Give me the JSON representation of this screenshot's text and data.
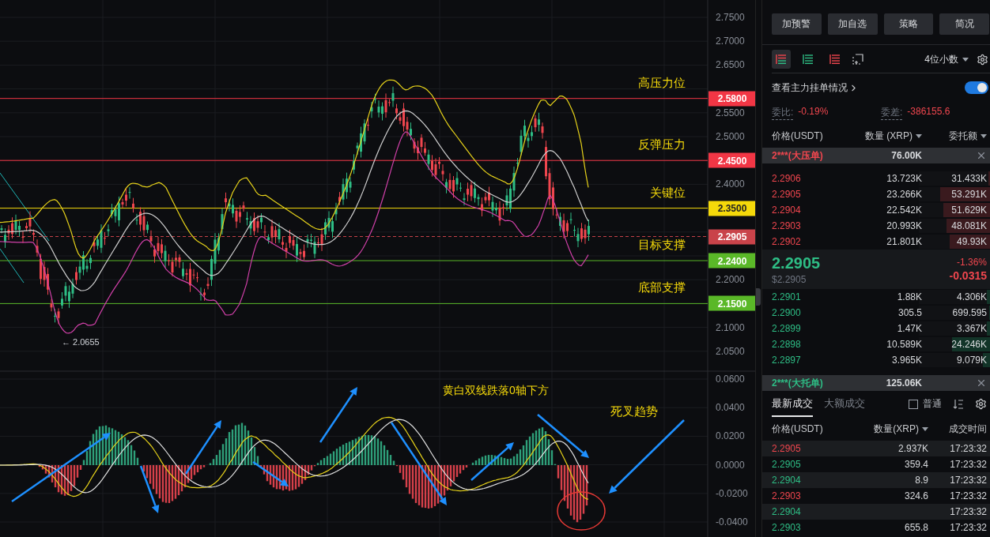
{
  "chart": {
    "price_ticks": [
      "2.7500",
      "2.7000",
      "2.6500",
      "2.5500",
      "2.5000",
      "2.4000",
      "2.2000",
      "2.1000",
      "2.0500"
    ],
    "macd_ticks": [
      "0.0600",
      "0.0400",
      "0.0200",
      "0.0000",
      "-0.0200",
      "-0.0400"
    ],
    "levels": [
      {
        "price": "2.5800",
        "kind": "resistance",
        "color": "#f23645",
        "note": "高压力位"
      },
      {
        "price": "2.4500",
        "kind": "resistance",
        "color": "#f23645",
        "note": "反弹压力"
      },
      {
        "price": "2.3500",
        "kind": "key",
        "color": "#f5d90a",
        "note": "关键位"
      },
      {
        "price": "2.2905",
        "kind": "current",
        "color": "#c9434a"
      },
      {
        "price": "2.2400",
        "kind": "support",
        "color": "#5ab828",
        "note": "目标支撑"
      },
      {
        "price": "2.1500",
        "kind": "support",
        "color": "#5ab828",
        "note": "底部支撑"
      }
    ],
    "low_marker": "← 2.0655",
    "macd_notes": [
      "黄白双线跌落0轴下方",
      "死叉趋势"
    ]
  },
  "panel": {
    "actions": [
      "加预警",
      "加自选",
      "策略",
      "简况"
    ],
    "depth_views": [
      {
        "kind": "both",
        "selected": true
      },
      {
        "kind": "bids",
        "selected": false
      },
      {
        "kind": "asks",
        "selected": false
      }
    ],
    "precision": "4位小数",
    "main_orders": {
      "label": "查看主力挂单情况",
      "on": true
    },
    "stats": [
      {
        "label": "委比:",
        "value": "-0.19%"
      },
      {
        "label": "委差:",
        "value": "-386155.6"
      }
    ],
    "book_columns": [
      "价格(USDT)",
      "数量 (XRP)",
      "委托额"
    ],
    "big_ask": {
      "label": "2***(大压单)",
      "amount": "76.00K"
    },
    "asks": [
      {
        "price": "2.2906",
        "qty": "13.723K",
        "total": "31.433K",
        "level": 0.02
      },
      {
        "price": "2.2905",
        "qty": "23.266K",
        "total": "53.291K",
        "level": 0.7
      },
      {
        "price": "2.2904",
        "qty": "22.542K",
        "total": "51.629K",
        "level": 0.66
      },
      {
        "price": "2.2903",
        "qty": "20.993K",
        "total": "48.081K",
        "level": 0.61
      },
      {
        "price": "2.2902",
        "qty": "21.801K",
        "total": "49.93K",
        "level": 0.57
      }
    ],
    "last": {
      "price": "2.2905",
      "usd": "$2.2905",
      "change_pct": "-1.36%",
      "change": "-0.0315"
    },
    "bids": [
      {
        "price": "2.2901",
        "qty": "1.88K",
        "total": "4.306K",
        "level": 0.05
      },
      {
        "price": "2.2900",
        "qty": "305.5",
        "total": "699.595",
        "level": 0.01
      },
      {
        "price": "2.2899",
        "qty": "1.47K",
        "total": "3.367K",
        "level": 0.04
      },
      {
        "price": "2.2898",
        "qty": "10.589K",
        "total": "24.246K",
        "level": 0.53
      },
      {
        "price": "2.2897",
        "qty": "3.965K",
        "total": "9.079K",
        "level": 0.1
      }
    ],
    "big_bid": {
      "label": "2***(大托单)",
      "amount": "125.06K"
    },
    "trade_tabs": [
      {
        "label": "最新成交",
        "selected": true
      },
      {
        "label": "大额成交",
        "selected": false
      }
    ],
    "normal_filter": {
      "label": "普通",
      "checked": false
    },
    "trade_columns": [
      "价格(USDT)",
      "数量(XRP)",
      "成交时间"
    ],
    "trades": [
      {
        "price": "2.2905",
        "qty": "2.937K",
        "time": "17:23:32",
        "color": "#f0464e"
      },
      {
        "price": "2.2905",
        "qty": "359.4",
        "time": "17:23:32",
        "color": "#2ebd85"
      },
      {
        "price": "2.2904",
        "qty": "8.9",
        "time": "17:23:32",
        "color": "#2ebd85"
      },
      {
        "price": "2.2903",
        "qty": "324.6",
        "time": "17:23:32",
        "color": "#f0464e"
      },
      {
        "price": "2.2904",
        "time": "17:23:32",
        "color": "#2ebd85"
      },
      {
        "price": "2.2903",
        "qty": "655.8",
        "time": "17:23:32",
        "color": "#2ebd85"
      }
    ]
  }
}
